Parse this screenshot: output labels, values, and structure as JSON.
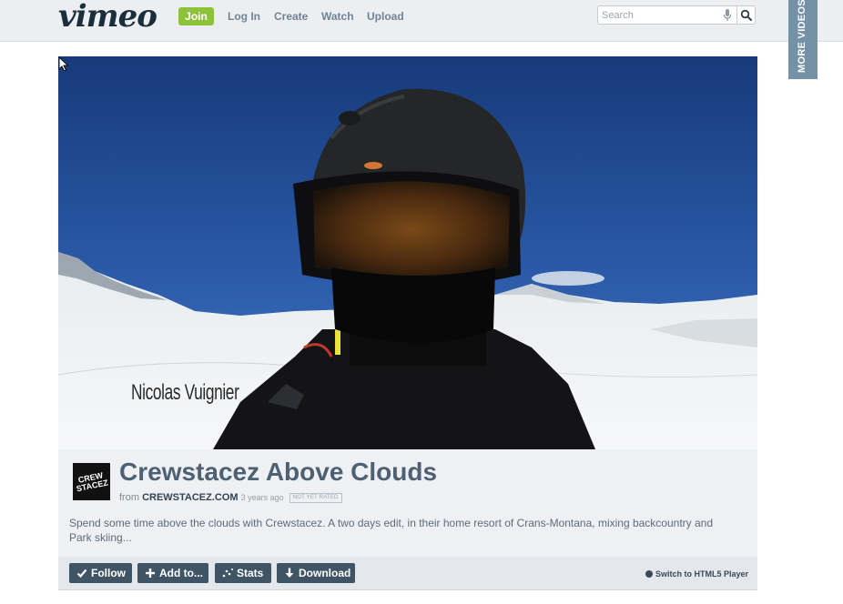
{
  "header": {
    "logo_text": "vimeo",
    "join_label": "Join",
    "nav": [
      "Log In",
      "Create",
      "Watch",
      "Upload"
    ],
    "search_placeholder": "Search",
    "more_videos_label": "MORE VIDEOS"
  },
  "player": {
    "overlay_name": "Nicolas Vuignier"
  },
  "video": {
    "channel_logo_text": "CREW STACEZ",
    "title": "Crewstacez Above Clouds",
    "from_label": "from",
    "channel_name": "CREWSTACEZ.COM",
    "posted_ago": "3 years ago",
    "rating_badge": "NOT YET RATED",
    "description": "Spend some time above the clouds with Crewstacez. A two days edit, in their home resort of Crans-Montana, mixing backcountry and Park skiing..."
  },
  "actions": {
    "follow_label": "Follow",
    "add_to_label": "Add to...",
    "stats_label": "Stats",
    "download_label": "Download",
    "html5_switch_label": "Switch to HTML5 Player"
  },
  "colors": {
    "join_green": "#8fc23b",
    "action_button": "#3f5566",
    "title_text": "#4d6172",
    "more_videos_tab": "#7591a6"
  }
}
